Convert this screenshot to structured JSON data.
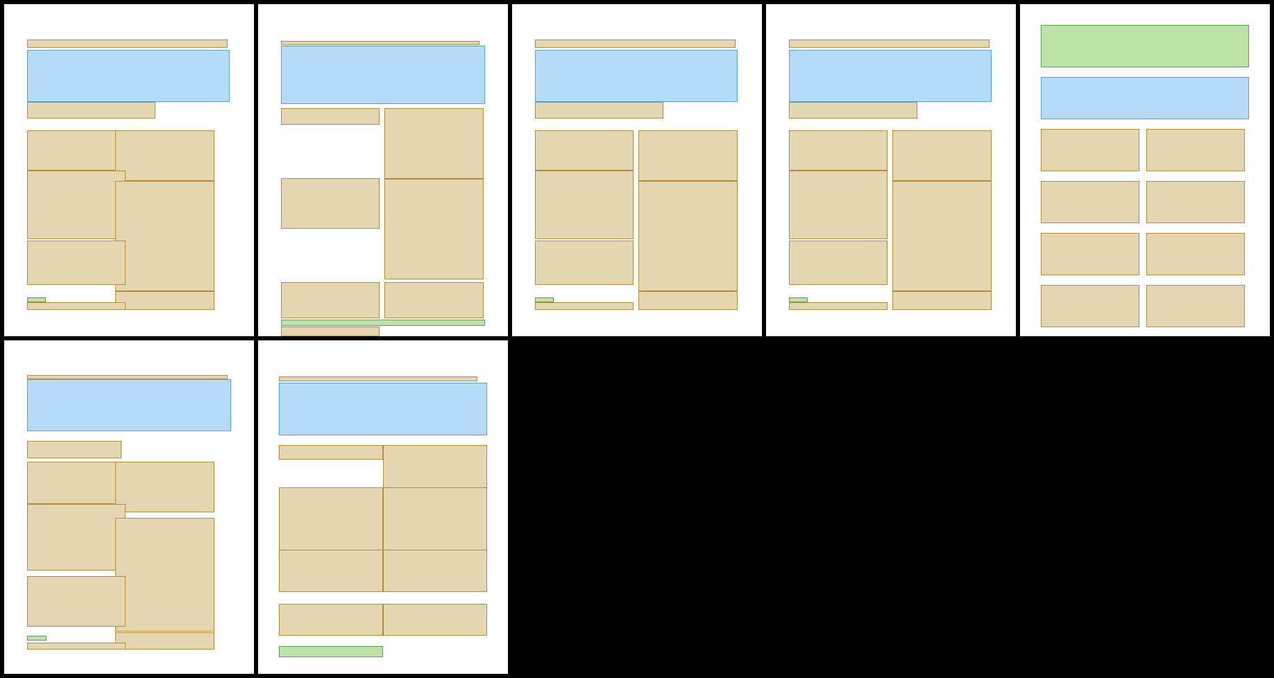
{
  "colors": {
    "background": "#000000",
    "page": "#ffffff",
    "text_fill": "#e3d6b1",
    "text_border": "#b08c3c",
    "figure_fill": "#b5dbf6",
    "figure_border": "#4ea3e0",
    "header_fill": "#bde3ab",
    "header_border": "#5aa34a"
  },
  "block_kinds": {
    "text": {
      "fill": "#e3d6b1",
      "border": "#b08c3c"
    },
    "figure": {
      "fill": "#b5dbf6",
      "border": "#4ea3e0"
    },
    "header": {
      "fill": "#bde3ab",
      "border": "#5aa34a"
    }
  },
  "pages": [
    {
      "name": "page-1",
      "columns": 2,
      "has_figure": true
    },
    {
      "name": "page-2",
      "columns": 2,
      "has_figure": true
    },
    {
      "name": "page-3",
      "columns": 2,
      "has_figure": true
    },
    {
      "name": "page-4",
      "columns": 2,
      "has_figure": true
    },
    {
      "name": "page-5",
      "columns": 2,
      "has_figure": true
    },
    {
      "name": "page-6",
      "columns": 2,
      "has_figure": true
    },
    {
      "name": "page-7",
      "columns": 2,
      "has_figure": true
    }
  ]
}
